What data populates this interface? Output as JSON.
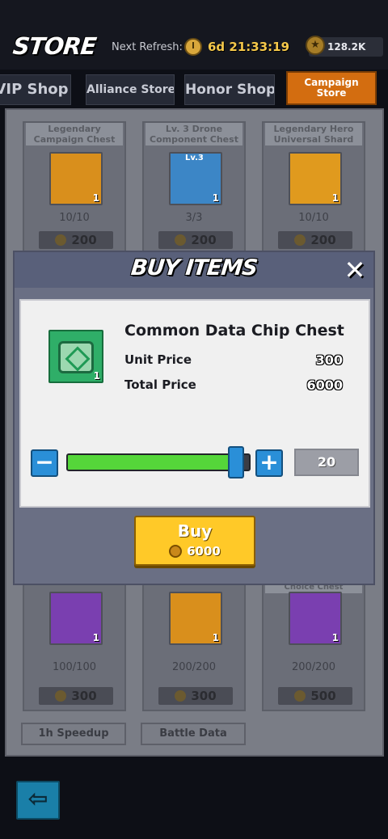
{
  "header": {
    "title": "STORE",
    "refresh_label": "Next Refresh:",
    "refresh_timer": "6d 21:33:19",
    "honor_balance": "128.2K",
    "icons": {
      "timer": "clock-icon",
      "currency": "honor-medal-icon"
    }
  },
  "tabs": [
    {
      "label": "VIP Shop",
      "active": false
    },
    {
      "label": "Alliance Store",
      "active": false
    },
    {
      "label": "Honor Shop",
      "active": false
    },
    {
      "label": "Campaign Store",
      "active": true
    }
  ],
  "shop": {
    "top_row": [
      {
        "title": "Legendary Campaign Chest",
        "qty": "1",
        "stock": "10/10",
        "price": "200",
        "color": "#d98f1c"
      },
      {
        "title": "Lv. 3 Drone Component Chest",
        "badge": "Lv.3",
        "qty": "1",
        "stock": "3/3",
        "price": "200",
        "color": "#3c86c6"
      },
      {
        "title": "Legendary Hero Universal Shard",
        "qty": "1",
        "stock": "10/10",
        "price": "200",
        "color": "#e09a1e"
      }
    ],
    "bottom_row": [
      {
        "title": "",
        "qty": "1",
        "stock": "100/100",
        "price": "300",
        "color": "#7a3fb0"
      },
      {
        "title": "",
        "qty": "1",
        "stock": "200/200",
        "price": "300",
        "color": "#d98f1c"
      },
      {
        "title": "Choice Chest",
        "qty": "1",
        "stock": "200/200",
        "price": "500",
        "color": "#7a3fb0"
      }
    ],
    "lower_labels": [
      "1h Speedup",
      "Battle Data"
    ]
  },
  "modal": {
    "title": "BUY ITEMS",
    "item_name": "Common Data Chip Chest",
    "item_qty": "1",
    "unit_price_label": "Unit Price",
    "unit_price": "300",
    "total_price_label": "Total Price",
    "total_price": "6000",
    "quantity": "20",
    "slider_fraction": 0.92,
    "buy_label": "Buy",
    "buy_cost": "6000",
    "accent_color": "#ffc928"
  }
}
